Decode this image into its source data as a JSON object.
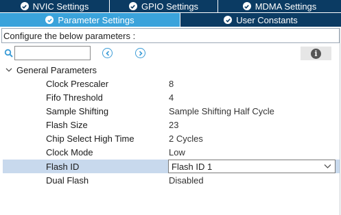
{
  "tabs_row1": [
    {
      "label": "NVIC Settings"
    },
    {
      "label": "GPIO Settings"
    },
    {
      "label": "MDMA Settings"
    }
  ],
  "tabs_row2": [
    {
      "label": "Parameter Settings",
      "active": true
    },
    {
      "label": "User Constants"
    }
  ],
  "description": "Configure the below parameters :",
  "search": {
    "value": "",
    "placeholder": ""
  },
  "group": {
    "label": "General Parameters"
  },
  "parameters": [
    {
      "name": "Clock Prescaler",
      "value": "8"
    },
    {
      "name": "Fifo Threshold",
      "value": "4"
    },
    {
      "name": "Sample Shifting",
      "value": "Sample Shifting Half Cycle"
    },
    {
      "name": "Flash Size",
      "value": "23"
    },
    {
      "name": "Chip Select High Time",
      "value": "2 Cycles"
    },
    {
      "name": "Clock Mode",
      "value": "Low"
    },
    {
      "name": "Flash ID",
      "value": "Flash ID 1"
    },
    {
      "name": "Dual Flash",
      "value": "Disabled"
    }
  ],
  "colors": {
    "tab_dark": "#0b3b63",
    "tab_active": "#3aa3db",
    "selected_row": "#c8d9ed",
    "accent": "#3a9bd6"
  }
}
